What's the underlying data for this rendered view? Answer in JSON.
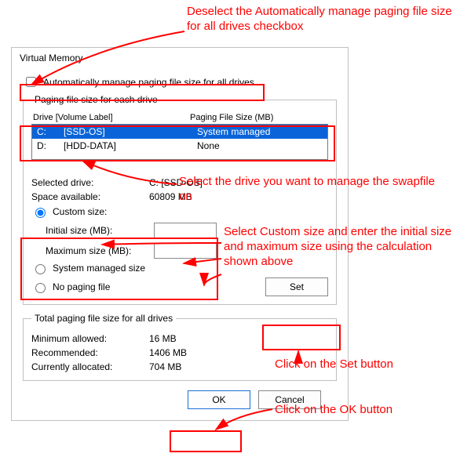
{
  "dialog": {
    "title": "Virtual Memory",
    "auto_manage_label": "Automatically manage paging file size for all drives",
    "auto_manage_checked": false,
    "group1_legend": "Paging file size for each drive",
    "list_header_drive": "Drive  [Volume Label]",
    "list_header_size": "Paging File Size (MB)",
    "drives": [
      {
        "letter": "C:",
        "label": "[SSD-OS]",
        "size": "System managed",
        "selected": true
      },
      {
        "letter": "D:",
        "label": "[HDD-DATA]",
        "size": "None",
        "selected": false
      }
    ],
    "selected_drive_label": "Selected drive:",
    "selected_drive_value": "C:  [SSD-OS]",
    "space_available_label": "Space available:",
    "space_available_value": "60809 MB",
    "radio_custom": "Custom size:",
    "initial_size_label": "Initial size (MB):",
    "initial_size_value": "",
    "maximum_size_label": "Maximum size (MB):",
    "maximum_size_value": "",
    "radio_system": "System managed size",
    "radio_none": "No paging file",
    "set_button": "Set",
    "group2_legend": "Total paging file size for all drives",
    "minimum_label": "Minimum allowed:",
    "minimum_value": "16 MB",
    "recommended_label": "Recommended:",
    "recommended_value": "1406 MB",
    "current_label": "Currently allocated:",
    "current_value": "704 MB",
    "ok_button": "OK",
    "cancel_button": "Cancel"
  },
  "annotations": {
    "a1": "Deselect the Automatically manage paging file size for all drives checkbox",
    "a2": "Select the drive you want to manage the swapfile on",
    "a3": "Select Custom size and enter the initial size and maximum size using the calculation shown above",
    "a4": "Click on the Set button",
    "a5": "Click on the OK button"
  }
}
